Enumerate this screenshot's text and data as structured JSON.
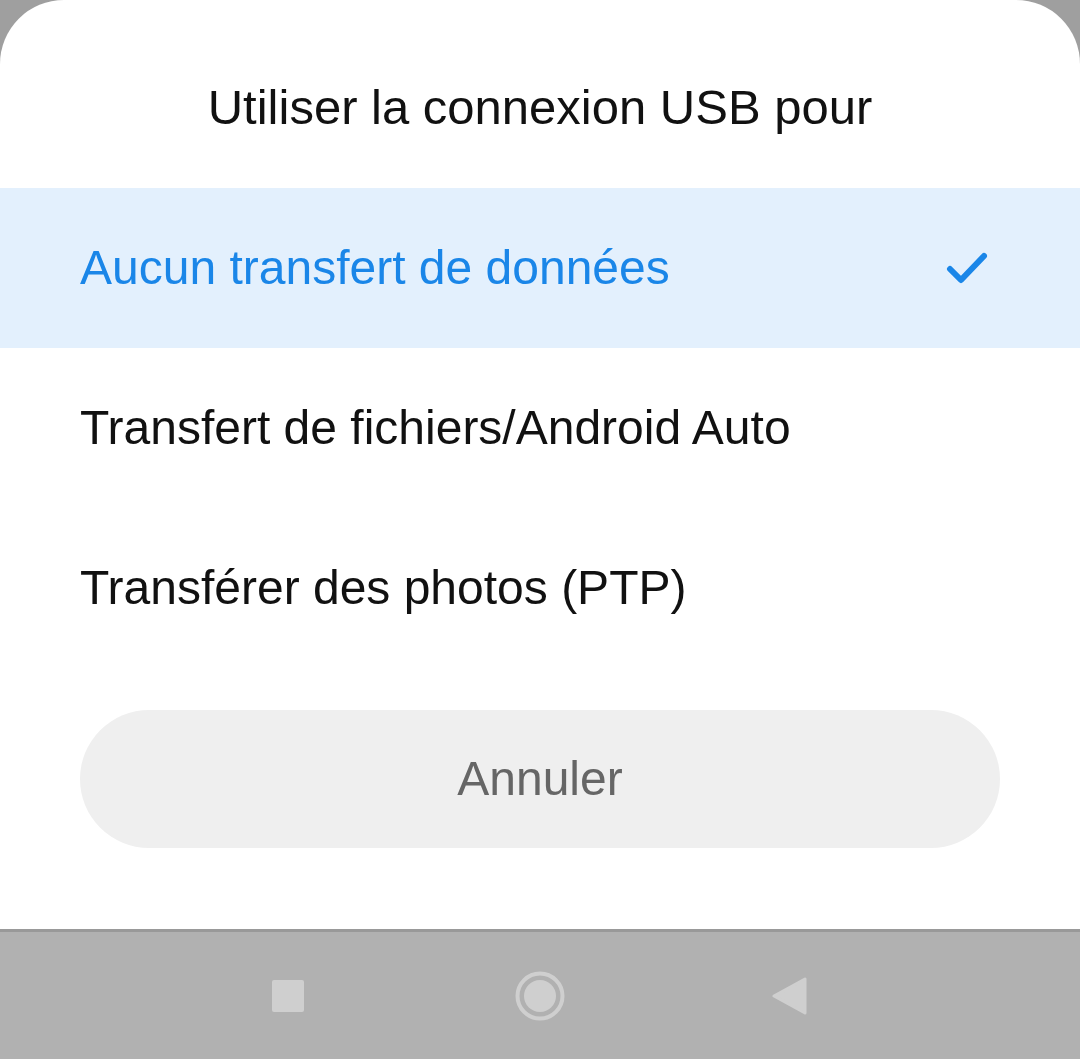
{
  "dialog": {
    "title": "Utiliser la connexion USB pour",
    "options": [
      {
        "label": "Aucun transfert de données",
        "selected": true
      },
      {
        "label": "Transfert de fichiers/Android Auto",
        "selected": false
      },
      {
        "label": "Transférer des photos (PTP)",
        "selected": false
      }
    ],
    "cancel_button": "Annuler"
  }
}
